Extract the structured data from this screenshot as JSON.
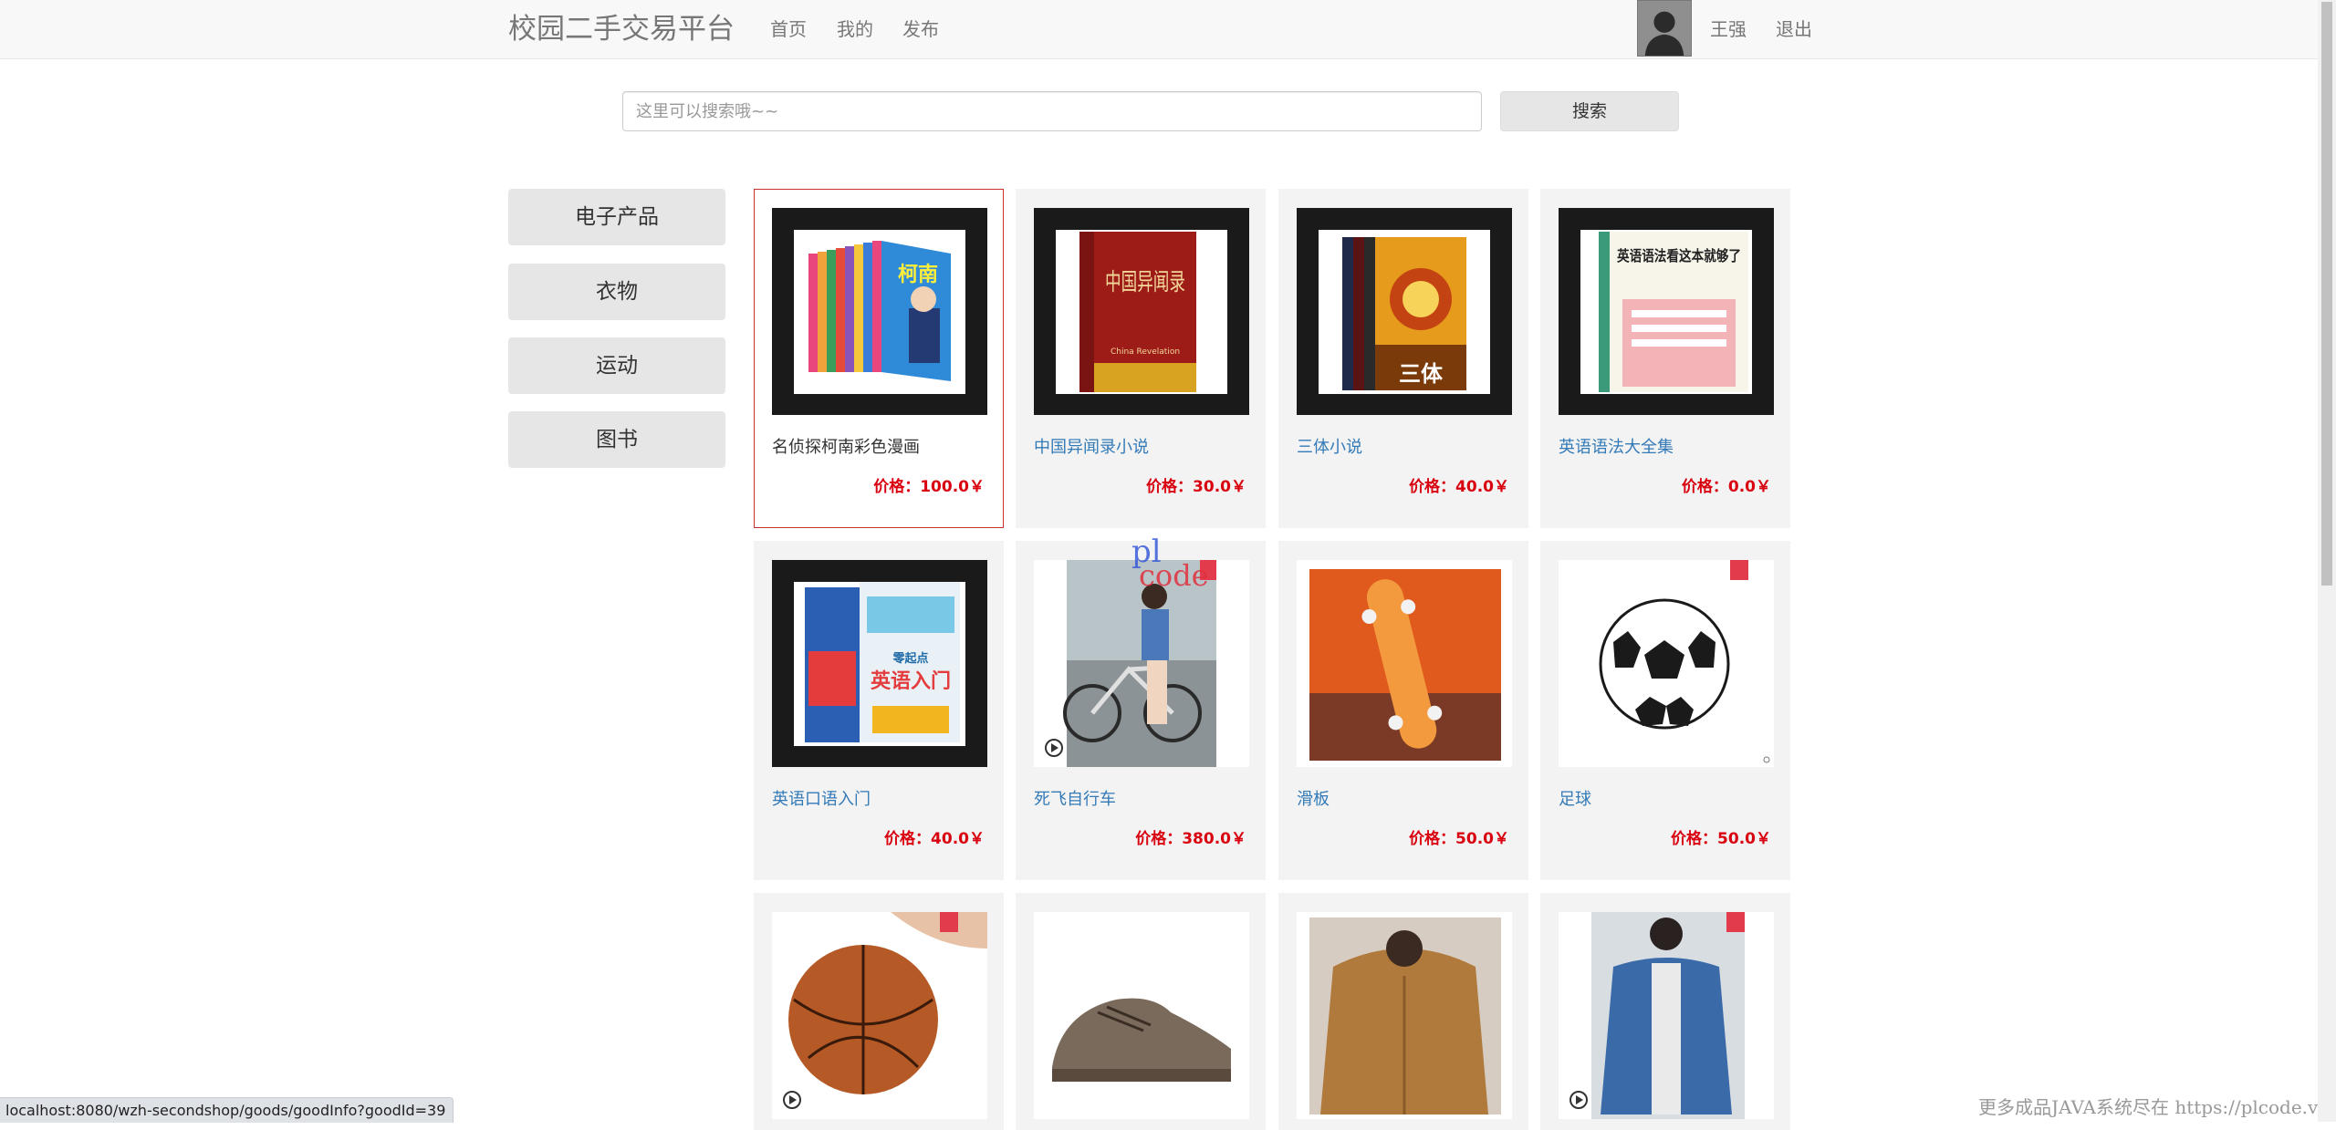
{
  "navbar": {
    "brand": "校园二手交易平台",
    "links": [
      "首页",
      "我的",
      "发布"
    ],
    "user_name": "王强",
    "logout_label": "退出"
  },
  "search": {
    "placeholder": "这里可以搜索哦~~",
    "button_label": "搜索"
  },
  "categories": [
    "电子产品",
    "衣物",
    "运动",
    "图书"
  ],
  "products": [
    {
      "title": "名侦探柯南彩色漫画",
      "price": "价格：100.0￥",
      "active": true
    },
    {
      "title": "中国异闻录小说",
      "price": "价格：30.0￥"
    },
    {
      "title": "三体小说",
      "price": "价格：40.0￥"
    },
    {
      "title": "英语语法大全集",
      "price": "价格：0.0￥"
    },
    {
      "title": "英语口语入门",
      "price": "价格：40.0￥"
    },
    {
      "title": "死飞自行车",
      "price": "价格：380.0￥"
    },
    {
      "title": "滑板",
      "price": "价格：50.0￥"
    },
    {
      "title": "足球",
      "price": "价格：50.0￥"
    },
    {
      "title": "",
      "price": ""
    },
    {
      "title": "",
      "price": ""
    },
    {
      "title": "",
      "price": ""
    },
    {
      "title": "",
      "price": ""
    }
  ],
  "book_cover_text": {
    "conan": "柯南",
    "china": "中国异闻录",
    "china_sub": "China Revelation",
    "threebody": "三体",
    "grammar": "英语语法看这本就够了",
    "oral_a": "英语入门",
    "oral_b": "零起点"
  },
  "status_bar": {
    "url": "localhost:8080/wzh-secondshop/goods/goodInfo?goodId=39"
  },
  "watermark": {
    "text": "更多成品JAVA系统尽在 https://plcode.vip",
    "logo_top": "pl",
    "logo_bottom": "code"
  },
  "colors": {
    "price": "#d9000f",
    "link": "#337ab7",
    "active_border": "#c9302c",
    "category_bg": "#e6e6e6"
  }
}
